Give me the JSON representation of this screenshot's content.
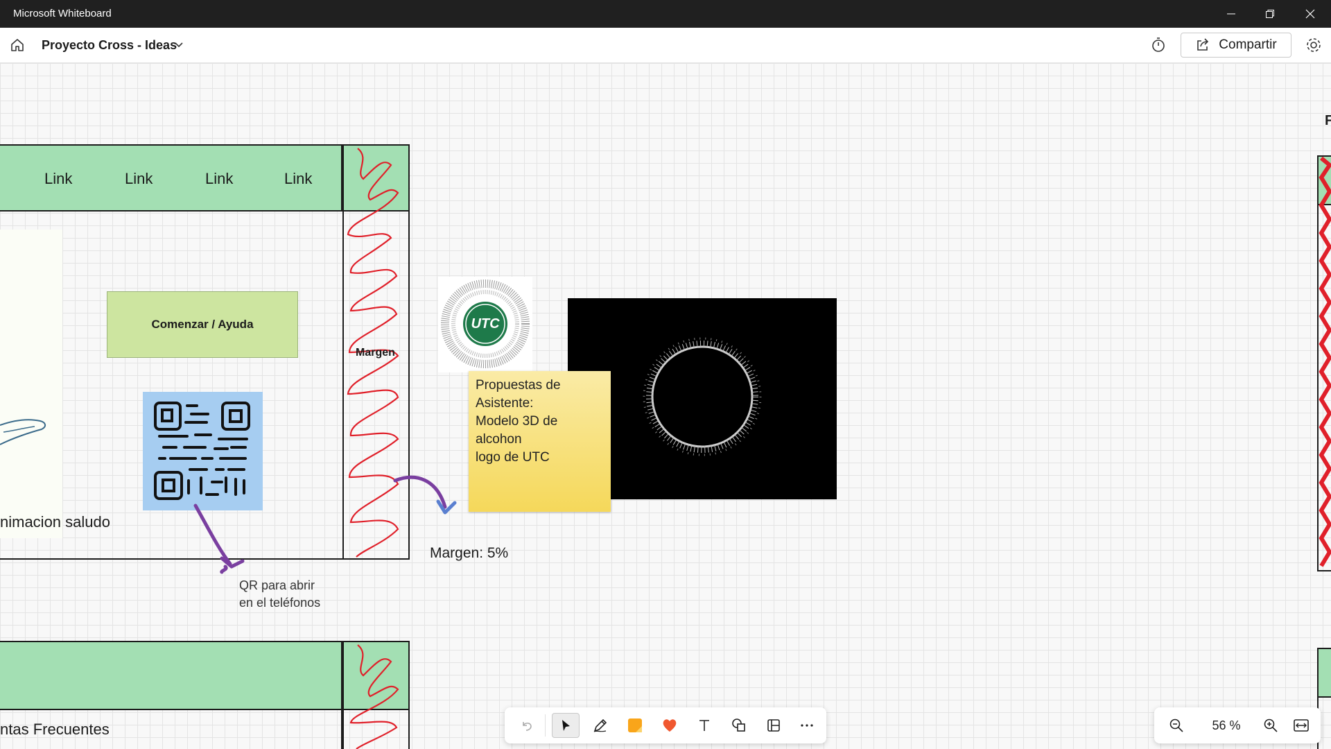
{
  "window": {
    "title": "Microsoft Whiteboard"
  },
  "header": {
    "board_title": "Proyecto Cross - Ideas",
    "share_label": "Compartir"
  },
  "canvas": {
    "nav_links": [
      "Link",
      "Link",
      "Link",
      "Link"
    ],
    "start_button": "Comenzar / Ayuda",
    "margen_label": "Margen",
    "animacion_label": "nimacion saludo",
    "qr_caption_1": "QR para abrir",
    "qr_caption_2": "en el teléfonos",
    "margen_pct": "Margen: 5%",
    "sticky_lines": [
      "Propuestas de",
      "Asistente:",
      "Modelo 3D de",
      "alcohon",
      "logo de UTC"
    ],
    "logo_text": "UTC",
    "preguntas_label": "ntas Frecuentes",
    "edge_text": "F"
  },
  "toolbar": {
    "tools": [
      "undo-icon",
      "select-icon",
      "pen-icon",
      "sticky-note-icon",
      "reaction-icon",
      "text-icon",
      "shapes-icon",
      "templates-icon",
      "more-icon"
    ]
  },
  "zoom": {
    "level": "56 %"
  },
  "colors": {
    "green_box": "#a3dfb3",
    "start_button": "#cde5a0",
    "qr_bg": "#a6cdf1",
    "sticky": "#f5db6e",
    "scribble": "#e0202a"
  }
}
